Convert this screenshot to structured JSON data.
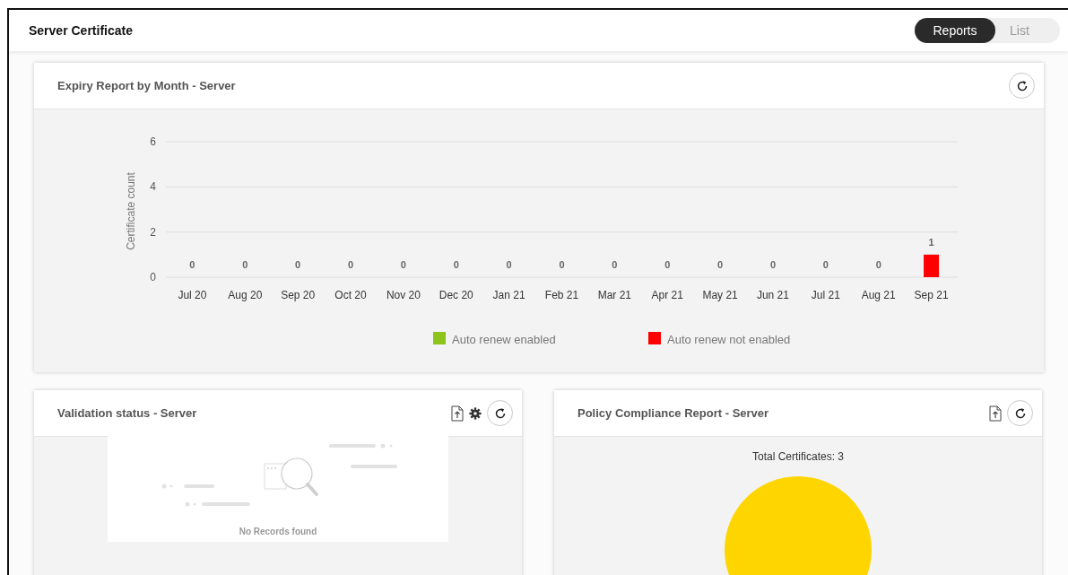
{
  "header": {
    "title": "Server Certificate",
    "view_toggle": [
      {
        "label": "Reports",
        "selected": true
      },
      {
        "label": "List",
        "selected": false
      }
    ]
  },
  "expiry_card": {
    "title": "Expiry Report by Month - Server",
    "tools": [
      {
        "kind": "refresh"
      }
    ],
    "chart_data": {
      "type": "bar",
      "ylabel": "Certificate count",
      "categories": [
        "Jul 20",
        "Aug 20",
        "Sep 20",
        "Oct 20",
        "Nov 20",
        "Dec 20",
        "Jan 21",
        "Feb 21",
        "Mar 21",
        "Apr 21",
        "May 21",
        "Jun 21",
        "Jul 21",
        "Aug 21",
        "Sep 21"
      ],
      "series": [
        {
          "name": "Auto renew enabled",
          "color": "#8cc41c",
          "values": [
            0,
            0,
            0,
            0,
            0,
            0,
            0,
            0,
            0,
            0,
            0,
            0,
            0,
            0,
            0
          ],
          "value_labels": [
            null,
            null,
            null,
            null,
            null,
            null,
            null,
            null,
            null,
            null,
            null,
            null,
            null,
            null,
            null
          ]
        },
        {
          "name": "Auto renew not enabled",
          "color": "#ff0000",
          "values": [
            0,
            0,
            0,
            0,
            0,
            0,
            0,
            0,
            0,
            0,
            0,
            0,
            0,
            0,
            1
          ],
          "value_labels": [
            "0",
            "0",
            "0",
            "0",
            "0",
            "0",
            "0",
            "0",
            "0",
            "0",
            "0",
            "0",
            "0",
            "0",
            "1"
          ]
        }
      ],
      "ylim": [
        0,
        6
      ],
      "yticks": [
        0,
        2,
        4,
        6
      ],
      "stacked": true
    }
  },
  "validation_card": {
    "title": "Validation status - Server",
    "tools": [
      {
        "kind": "export"
      },
      {
        "kind": "settings"
      },
      {
        "kind": "refresh"
      }
    ],
    "empty_message": "No Records found"
  },
  "policy_card": {
    "title": "Policy Compliance Report - Server",
    "tools": [
      {
        "kind": "export"
      },
      {
        "kind": "refresh"
      }
    ],
    "total_label": "Total Certificates: 3"
  }
}
